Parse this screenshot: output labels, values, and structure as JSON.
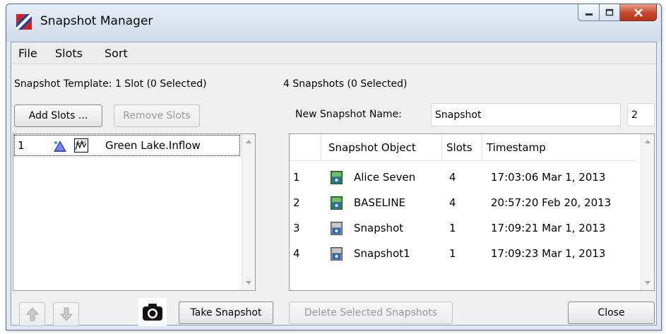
{
  "window": {
    "title": "Snapshot Manager",
    "controls": [
      "minimize",
      "maximize",
      "close"
    ]
  },
  "menu": {
    "items": [
      {
        "label": "File"
      },
      {
        "label": "Slots"
      },
      {
        "label": "Sort"
      }
    ]
  },
  "left": {
    "header": "Snapshot Template: 1 Slot (0 Selected)",
    "add_slots_label": "Add Slots ...",
    "remove_slots_label": "Remove Slots",
    "slots": [
      {
        "index": "1",
        "name": "Green Lake.Inflow",
        "icons": [
          "inflow-icon",
          "series-slot-icon"
        ]
      }
    ],
    "take_snapshot_label": "Take Snapshot",
    "move_up_icon": "arrow-up-icon",
    "move_down_icon": "arrow-down-icon",
    "camera_icon": "camera-icon"
  },
  "right": {
    "header": "4 Snapshots (0 Selected)",
    "name_label": "New Snapshot Name:",
    "name_value": "Snapshot",
    "count_value": "2",
    "columns": [
      "Snapshot Object",
      "Slots",
      "Timestamp"
    ],
    "rows": [
      {
        "index": "1",
        "object": "Alice Seven",
        "slots": "4",
        "timestamp": "17:03:06 Mar 1, 2013",
        "icon_color": "#2f8a2f"
      },
      {
        "index": "2",
        "object": "BASELINE",
        "slots": "4",
        "timestamp": "20:57:20 Feb 20, 2013",
        "icon_color": "#2f8a2f"
      },
      {
        "index": "3",
        "object": "Snapshot",
        "slots": "1",
        "timestamp": "17:09:21 Mar 1, 2013",
        "icon_color": "#8a8a8a"
      },
      {
        "index": "4",
        "object": "Snapshot1",
        "slots": "1",
        "timestamp": "17:09:23 Mar 1, 2013",
        "icon_color": "#8a8a8a"
      }
    ],
    "delete_label": "Delete Selected Snapshots",
    "close_label": "Close"
  },
  "colors": {
    "title_bar": "#dbe5f1",
    "close_button": "#c2472d",
    "app_icon_red": "#d11f25",
    "app_icon_blue": "#1c3f94"
  }
}
